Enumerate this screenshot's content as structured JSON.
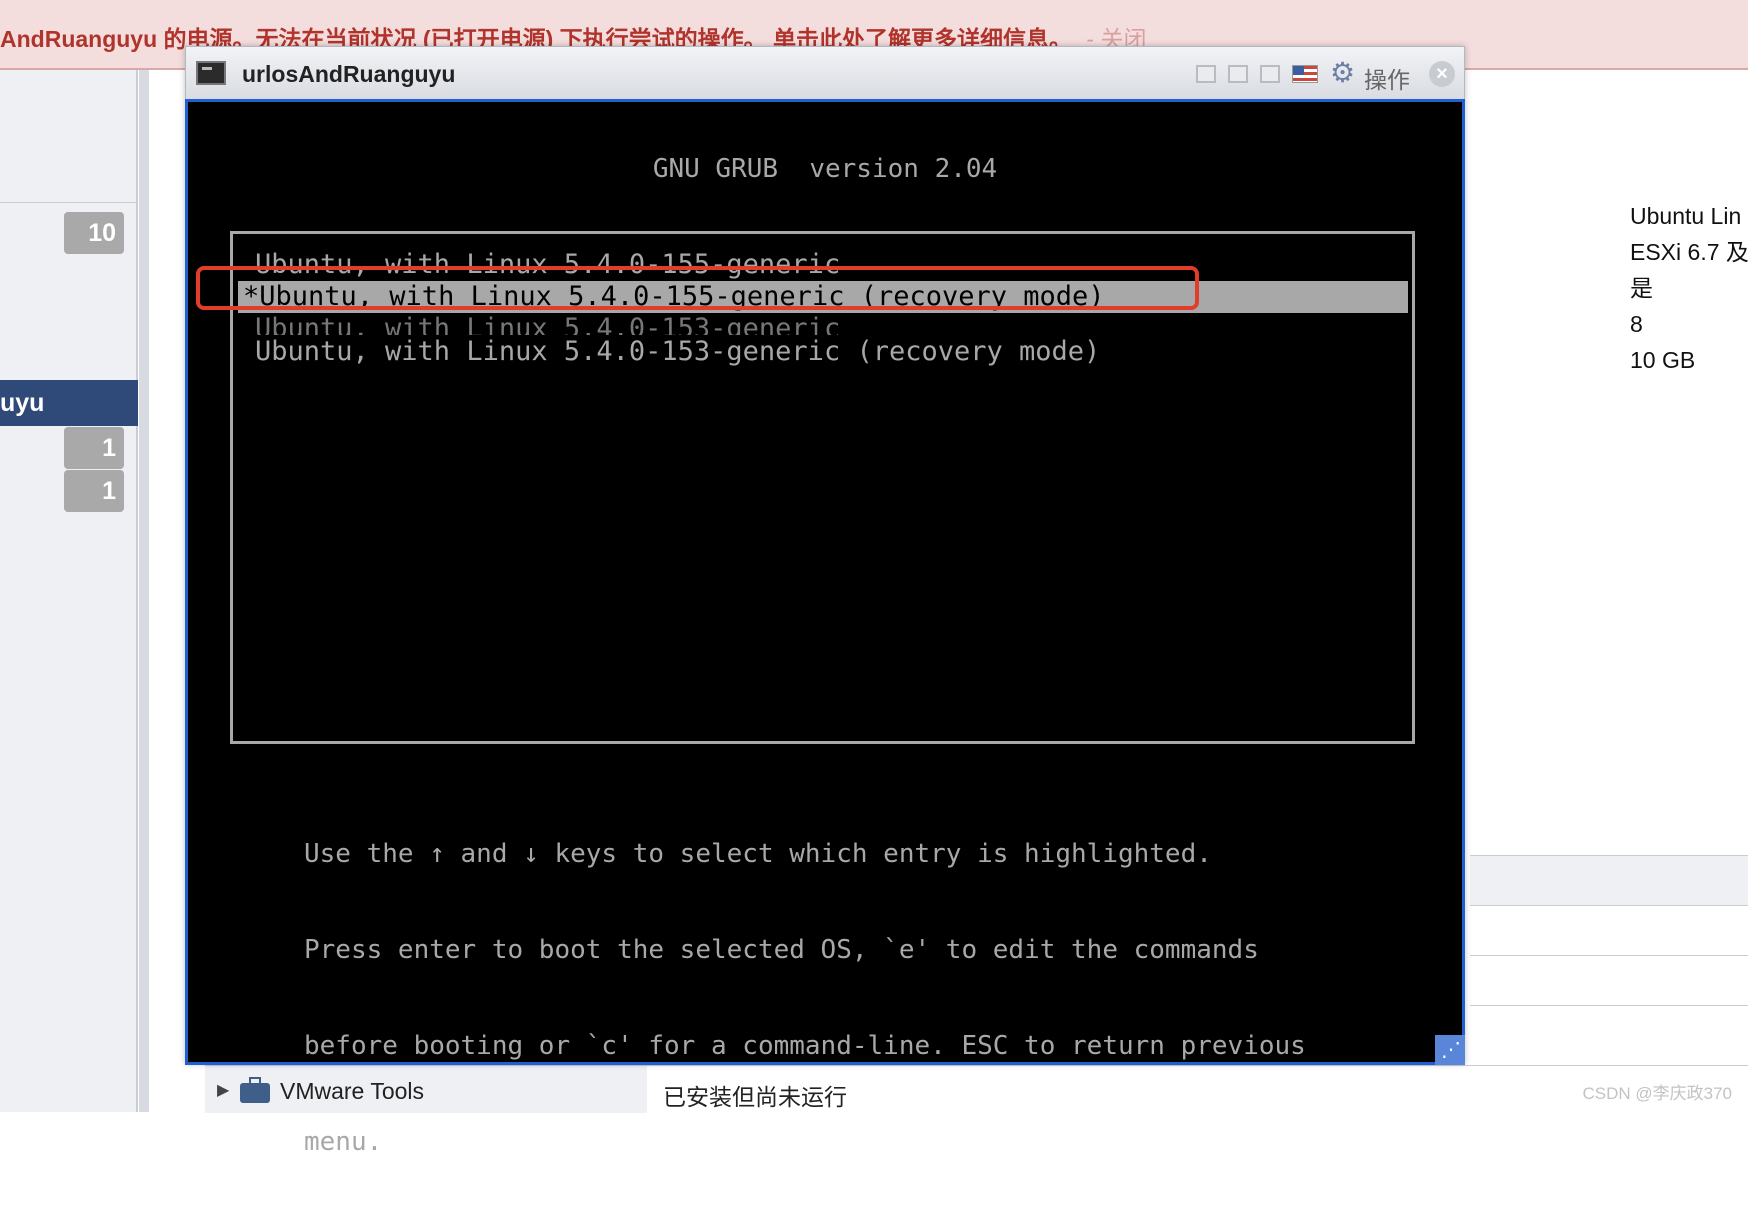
{
  "banner": {
    "message": "AndRuanguyu 的电源。无法在当前状况 (已打开电源) 下执行尝试的操作。 单击此处了解更多详细信息。",
    "close_label": "- 关闭"
  },
  "sidebar": {
    "badges": [
      "10",
      "1",
      "1"
    ],
    "selected_item_label": "uyu"
  },
  "console": {
    "title": "urlosAndRuanguyu",
    "actions_label": "操作",
    "grub": {
      "header": "GNU GRUB  version 2.04",
      "menu_items": [
        "Ubuntu, with Linux 5.4.0-155-generic",
        "*Ubuntu, with Linux 5.4.0-155-generic (recovery mode)",
        "Ubuntu, with Linux 5.4.0-153-generic",
        "Ubuntu, with Linux 5.4.0-153-generic (recovery mode)"
      ],
      "selected_index": 1,
      "help_lines": [
        "Use the ↑ and ↓ keys to select which entry is highlighted.",
        "Press enter to boot the selected OS, `e' to edit the commands",
        "before booting or `c' for a command-line. ESC to return previous",
        "menu."
      ]
    }
  },
  "info_panel": {
    "values": [
      "Ubuntu Lin",
      "ESXi 6.7 及",
      "是",
      "8",
      "10 GB"
    ]
  },
  "bottom_row": {
    "label": "VMware Tools",
    "value": "已安装但尚未运行"
  },
  "watermark": "CSDN @李庆政370",
  "colors": {
    "banner_text": "#b0342c",
    "highlight_box": "#e03d2b",
    "console_border": "#1f5fd1",
    "selected_sidebar": "#2f4a78"
  },
  "icons": [
    "vm-console-icon",
    "flag-us-icon",
    "gear-icon",
    "close-icon",
    "resize-grip-icon",
    "vmware-tools-icon",
    "expand-arrow-icon"
  ]
}
